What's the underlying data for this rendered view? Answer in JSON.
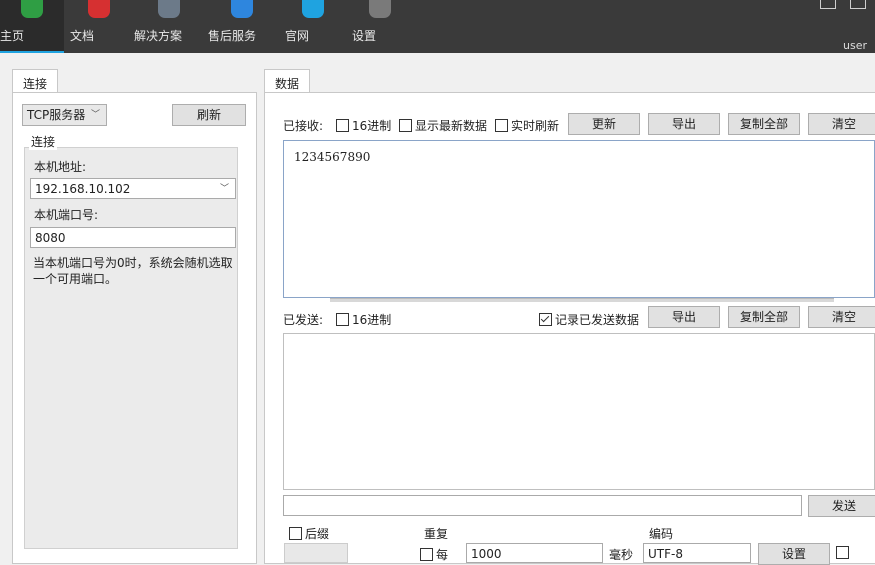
{
  "nav": {
    "items": [
      {
        "label": "主页",
        "icon": "shield-icon",
        "color": "#2f9e44"
      },
      {
        "label": "文档",
        "icon": "document-icon",
        "color": "#d63031"
      },
      {
        "label": "解决方案",
        "icon": "magnifier-icon",
        "color": "#6c7a89"
      },
      {
        "label": "售后服务",
        "icon": "person-icon",
        "color": "#2e86de"
      },
      {
        "label": "官网",
        "icon": "cloud-icon",
        "color": "#1fa3e0"
      },
      {
        "label": "设置",
        "icon": "gear-icon",
        "color": "#7a7a7a"
      }
    ],
    "user": "user"
  },
  "left": {
    "tab": "连接",
    "mode": "TCP服务器",
    "refresh": "刷新",
    "group": "连接",
    "addr_label": "本机地址:",
    "addr_value": "192.168.10.102",
    "port_label": "本机端口号:",
    "port_value": "8080",
    "hint": "当本机端口号为0时，系统会随机选取一个可用端口。"
  },
  "right": {
    "tab": "数据",
    "recv_label": "已接收:",
    "recv_hex": "16进制",
    "recv_latest": "显示最新数据",
    "recv_realtime": "实时刷新",
    "update": "更新",
    "export": "导出",
    "copy_all": "复制全部",
    "clear": "清空",
    "recv_text": "1234567890",
    "sent_label": "已发送:",
    "sent_hex": "16进制",
    "log_sent": "记录已发送数据",
    "send": "发送",
    "suffix": "后缀",
    "repeat": "重复",
    "every": "每",
    "every_value": "1000",
    "ms": "毫秒",
    "encoding": "编码",
    "encoding_value": "UTF-8",
    "settings": "设置"
  }
}
